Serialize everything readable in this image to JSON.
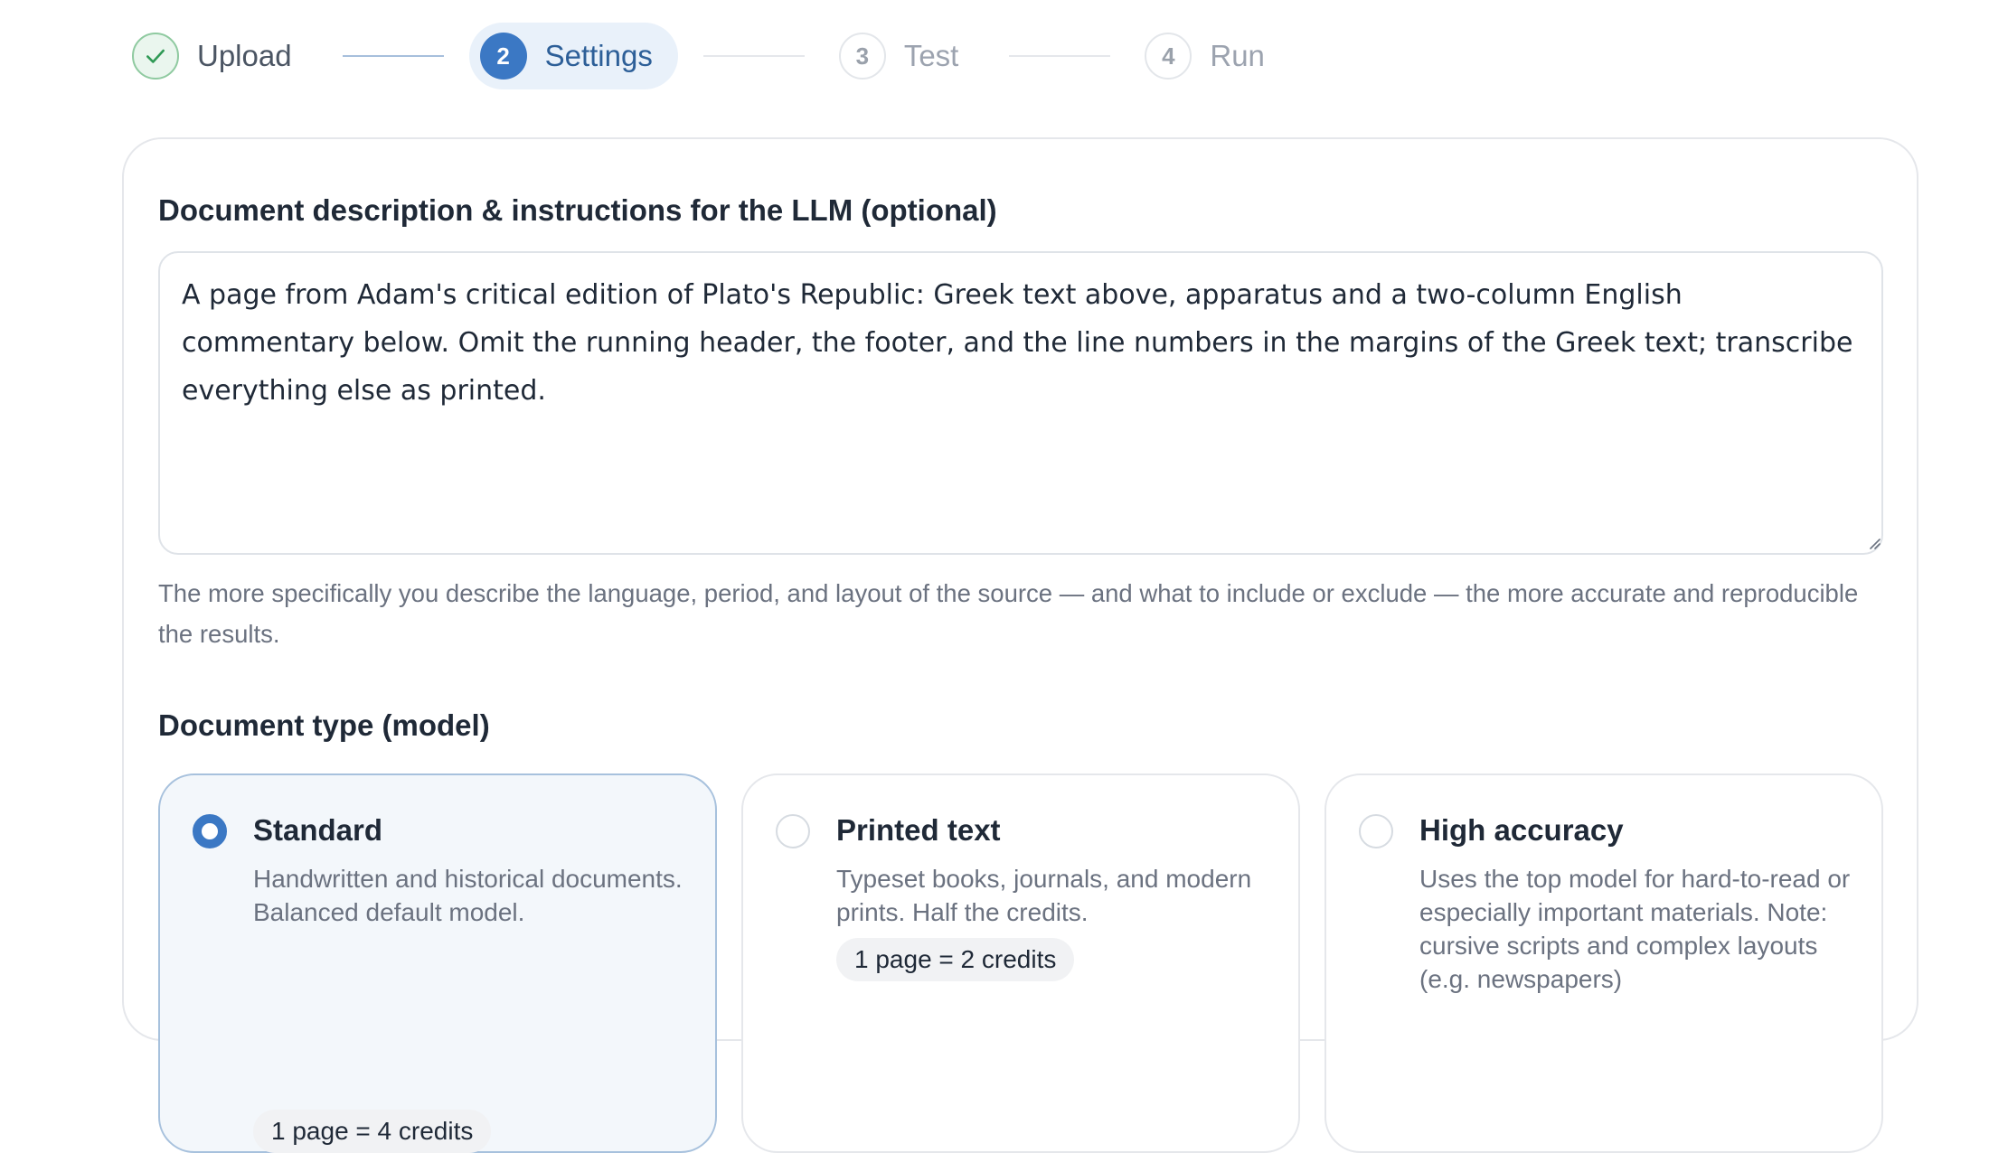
{
  "stepper": {
    "steps": [
      {
        "number": "",
        "label": "Upload",
        "state": "done",
        "icon": "check-icon"
      },
      {
        "number": "2",
        "label": "Settings",
        "state": "active"
      },
      {
        "number": "3",
        "label": "Test",
        "state": "pending"
      },
      {
        "number": "4",
        "label": "Run",
        "state": "pending"
      }
    ]
  },
  "description": {
    "label": "Document description & instructions for the LLM (optional)",
    "value": "A page from Adam's critical edition of Plato's Republic: Greek text above, apparatus and a two-column English commentary below. Omit the running header, the footer, and the line numbers in the margins of the Greek text; transcribe everything else as printed.",
    "hint": "The more specifically you describe the language, period, and layout of the source — and what to include or exclude — the more accurate and reproducible the results."
  },
  "document_type": {
    "label": "Document type (model)",
    "options": [
      {
        "title": "Standard",
        "description": "Handwritten and historical documents. Balanced default model.",
        "badge": "1 page = 4 credits",
        "selected": true
      },
      {
        "title": "Printed text",
        "description": "Typeset books, journals, and modern prints. Half the credits.",
        "badge": "1 page = 2 credits",
        "selected": false
      },
      {
        "title": "High accuracy",
        "description": "Uses the top model for hard-to-read or especially important materials. Note: cursive scripts and complex layouts (e.g. newspapers)",
        "selected": false
      }
    ]
  },
  "colors": {
    "accent": "#3b78c4",
    "done": "#2f9a55",
    "muted_text": "#6b7280"
  }
}
